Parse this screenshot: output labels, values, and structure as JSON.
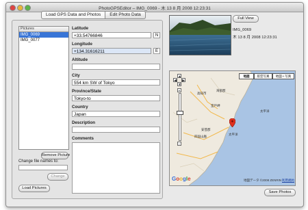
{
  "window": {
    "title": "PhotoGPSEditor – IMG_0069 - 木 13 8 月 2008 12:23:31"
  },
  "tabs": [
    {
      "label": "Load GPS Data and Photos"
    },
    {
      "label": "Edit Photo Data"
    }
  ],
  "pictures": {
    "header": "Pictures",
    "items": [
      "IMG_0069",
      "IMG_0077"
    ],
    "selected_index": 0
  },
  "buttons": {
    "remove_picture": "Remove Picture",
    "change": "Change",
    "load_pictures": "Load Pictures",
    "full_view": "Full View",
    "save_photos": "Save Photos"
  },
  "rename": {
    "label": "Change file names to:",
    "value": ""
  },
  "form": {
    "latitude": {
      "label": "Latitude",
      "value": "+33.54766846",
      "hemisphere": "N"
    },
    "longitude": {
      "label": "Longitude",
      "value": "+134.31616211",
      "hemisphere": "E"
    },
    "altitude": {
      "label": "Altitude",
      "value": ""
    },
    "city": {
      "label": "City",
      "value": "554 km SW of Tokyo"
    },
    "province": {
      "label": "Province/State",
      "value": "Tokyo-to"
    },
    "country": {
      "label": "Country",
      "value": "Japan"
    },
    "description": {
      "label": "Description",
      "value": ""
    },
    "comments": {
      "label": "Comments",
      "value": ""
    }
  },
  "photo_meta": {
    "name": "IMG_0069",
    "date": "木 13 8 月 2008 12:23:31"
  },
  "map": {
    "types": [
      "地図",
      "航空写真",
      "地図＋写真"
    ],
    "selected_type": "地図",
    "place_labels": [
      "高知市",
      "室戸岬",
      "海部郡",
      "太平洋",
      "安芸郡",
      "四国山脈",
      "太平洋"
    ],
    "google_logo": "Google",
    "copyright": "地図データ ©2008 ZENRIN -",
    "terms": "利用規約",
    "pan_controls": [
      "▲",
      "◀",
      "▶",
      "▼"
    ],
    "zoom_in": "+",
    "zoom_out": "−"
  }
}
